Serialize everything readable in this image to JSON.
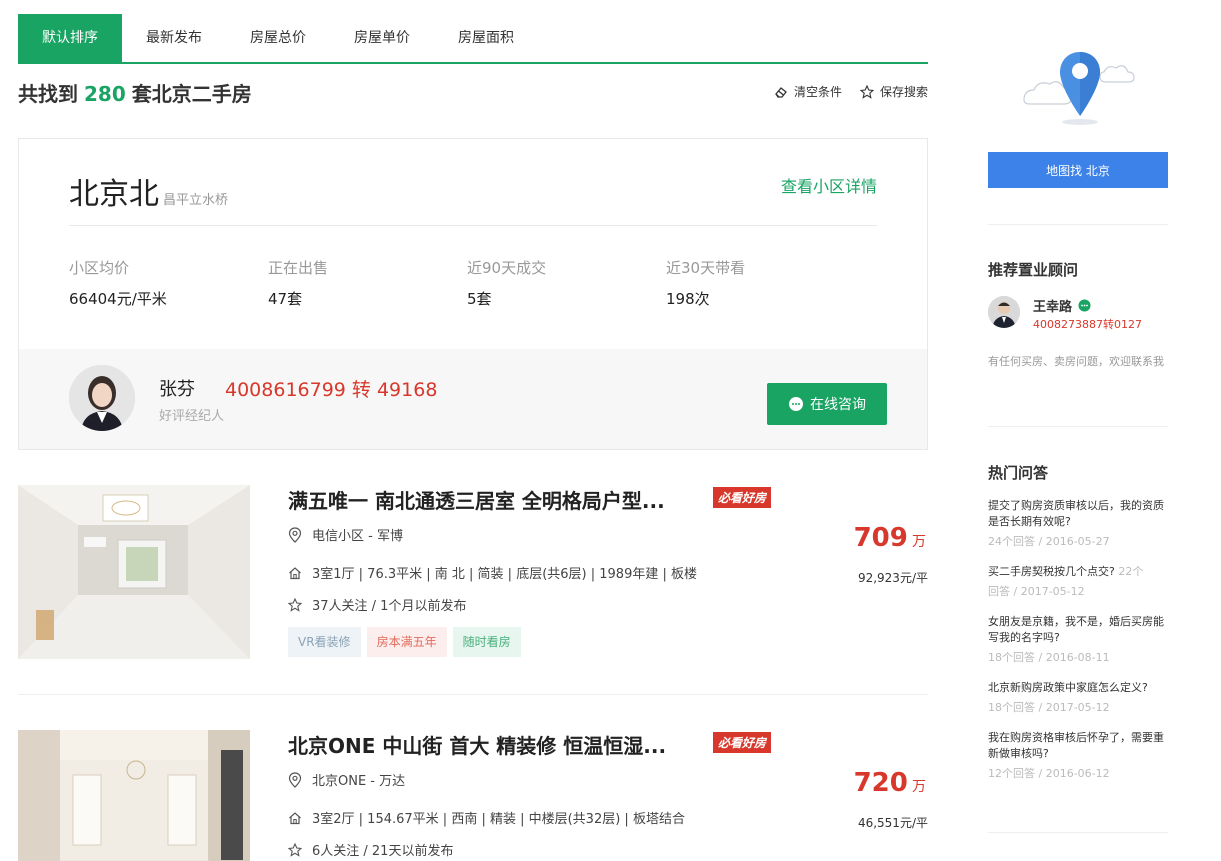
{
  "tabs": [
    "默认排序",
    "最新发布",
    "房屋总价",
    "房屋单价",
    "房屋面积"
  ],
  "headline": {
    "prefix": "共找到",
    "count": "280",
    "suffix": "套北京二手房"
  },
  "tools": {
    "clear": "清空条件",
    "save": "保存搜索"
  },
  "community": {
    "name": "北京北",
    "area": "昌平立水桥",
    "detail_link": "查看小区详情",
    "stats": [
      {
        "label": "小区均价",
        "value": "66404元/平米"
      },
      {
        "label": "正在出售",
        "value": "47套"
      },
      {
        "label": "近90天成交",
        "value": "5套"
      },
      {
        "label": "近30天带看",
        "value": "198次"
      }
    ],
    "agent": {
      "name": "张芬",
      "phone": "4008616799 转 49168",
      "tag": "好评经纪人",
      "consult": "在线咨询"
    }
  },
  "listings": [
    {
      "title": "满五唯一 南北通透三居室 全明格局户型...",
      "badge": "必看好房",
      "location": "电信小区 - 军博",
      "info": "3室1厅 | 76.3平米 | 南 北 | 简装 | 底层(共6层) | 1989年建 | 板楼",
      "follow": "37人关注 / 1个月以前发布",
      "price": "709",
      "price_unit": "万",
      "unit_price": "92,923元/平",
      "tags": [
        "VR看装修",
        "房本满五年",
        "随时看房"
      ]
    },
    {
      "title": "北京ONE 中山街 首大 精装修 恒温恒湿...",
      "badge": "必看好房",
      "location": "北京ONE - 万达",
      "info": "3室2厅 | 154.67平米 | 西南 | 精装 | 中楼层(共32层) | 板塔结合",
      "follow": "6人关注 / 21天以前发布",
      "price": "720",
      "price_unit": "万",
      "unit_price": "46,551元/平"
    }
  ],
  "sidebar": {
    "map_button": "地图找 北京",
    "advisor_heading": "推荐置业顾问",
    "advisor": {
      "name": "王幸路",
      "phone": "4008273887转0127"
    },
    "advisor_note": "有任何买房、卖房问题，欢迎联系我",
    "qa_heading": "热门问答",
    "qa": [
      {
        "q": "提交了购房资质审核以后，我的资质是否长期有效呢?",
        "meta": "24个回答 / 2016-05-27"
      },
      {
        "q": "买二手房契税按几个点交?",
        "meta_inline": "22个",
        "meta": "回答 / 2017-05-12"
      },
      {
        "q": "女朋友是京籍，我不是，婚后买房能写我的名字吗?",
        "meta": "18个回答 / 2016-08-11"
      },
      {
        "q": "北京新购房政策中家庭怎么定义?",
        "meta": "18个回答 / 2017-05-12"
      },
      {
        "q": "我在购房资格审核后怀孕了，需要重新做审核吗?",
        "meta": "12个回答 / 2016-06-12"
      }
    ]
  }
}
